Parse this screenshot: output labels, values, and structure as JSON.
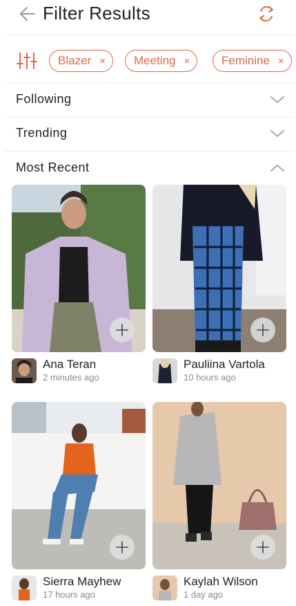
{
  "header": {
    "title": "Filter Results",
    "back_icon": "arrow-left-icon",
    "refresh_icon": "refresh-icon"
  },
  "filters": {
    "icon": "sliders-icon",
    "chips": [
      {
        "label": "Blazer",
        "remove": "×"
      },
      {
        "label": "Meeting",
        "remove": "×"
      },
      {
        "label": "Feminine",
        "remove": "×"
      }
    ]
  },
  "sections": {
    "following": {
      "label": "Following",
      "state": "collapsed"
    },
    "trending": {
      "label": "Trending",
      "state": "collapsed"
    },
    "most_recent": {
      "label": "Most Recent",
      "state": "expanded"
    }
  },
  "posts": [
    {
      "user": "Ana Teran",
      "time": "2 minutes ago"
    },
    {
      "user": "Pauliina Vartola",
      "time": "10 hours ago"
    },
    {
      "user": "Sierra Mayhew",
      "time": "17 hours ago"
    },
    {
      "user": "Kaylah Wilson",
      "time": "1 day ago"
    }
  ],
  "colors": {
    "accent": "#e16842",
    "text": "#1f1f1f",
    "muted": "#8a8a8a",
    "divider": "#ececec"
  }
}
